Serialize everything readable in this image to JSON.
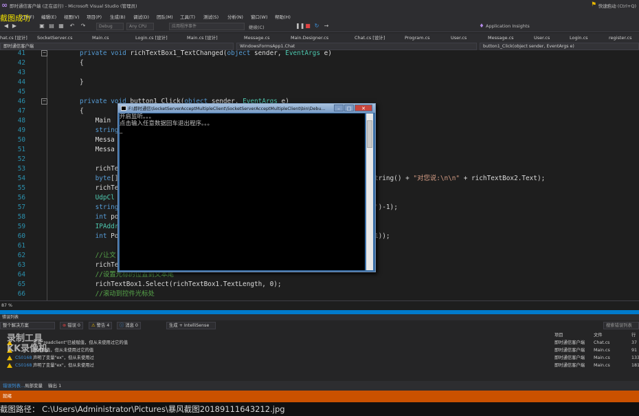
{
  "title_bar": {
    "title": "即时通信客户端 (正在运行) - Microsoft Visual Studio (管理员)",
    "signin": "快速启动 (Ctrl+Q)",
    "capture_note": "截图成功"
  },
  "menu": [
    "文件(F)",
    "编辑(E)",
    "视图(V)",
    "项目(P)",
    "生成(B)",
    "调试(D)",
    "团队(M)",
    "工具(T)",
    "测试(S)",
    "分析(N)",
    "窗口(W)",
    "帮助(H)"
  ],
  "toolbar": {
    "config": "Debug",
    "platform": "Any CPU",
    "process": "应用程序事件",
    "continue": "继续(C)",
    "app_insights": "Application Insights"
  },
  "tabs": [
    "hat.cs [设计]",
    "SocketServer.cs",
    "Main.cs",
    "Login.cs [设计]",
    "Main.cs [设计]",
    "Message.cs",
    "Main.Designer.cs",
    "Chat.cs [设计]",
    "Program.cs",
    "User.cs",
    "Message.cs",
    "User.cs",
    "Login.cs",
    "register.cs"
  ],
  "nav": {
    "project": "即时通信客户端",
    "class": "WindowsFormsApp1.Chat",
    "member": "button1_Click(object sender, EventArgs e)"
  },
  "code_lines": [
    {
      "n": "41",
      "parts": [
        [
          "kw",
          "private void "
        ],
        [
          "pl",
          "richTextBox1_TextChanged("
        ],
        [
          "kw",
          "object"
        ],
        [
          "pl",
          " sender, "
        ],
        [
          "ty",
          "EventArgs"
        ],
        [
          "pl",
          " e)"
        ]
      ]
    },
    {
      "n": "42",
      "parts": [
        [
          "pl",
          "{"
        ]
      ]
    },
    {
      "n": "43",
      "parts": [
        [
          "pl",
          ""
        ]
      ]
    },
    {
      "n": "44",
      "parts": [
        [
          "pl",
          "}"
        ]
      ]
    },
    {
      "n": "45",
      "parts": [
        [
          "pl",
          ""
        ]
      ]
    },
    {
      "n": "46",
      "parts": [
        [
          "kw",
          "private void "
        ],
        [
          "pl",
          "button1_Click("
        ],
        [
          "kw",
          "object"
        ],
        [
          "pl",
          " sender, "
        ],
        [
          "ty",
          "EventArgs"
        ],
        [
          "pl",
          " e)"
        ]
      ]
    },
    {
      "n": "47",
      "parts": [
        [
          "pl",
          "{"
        ]
      ]
    },
    {
      "n": "48",
      "parts": [
        [
          "pl",
          "    Main "
        ]
      ]
    },
    {
      "n": "49",
      "parts": [
        [
          "pl",
          "    "
        ],
        [
          "kw",
          "string"
        ]
      ]
    },
    {
      "n": "50",
      "parts": [
        [
          "pl",
          "    Messa                                                    oString());"
        ]
      ]
    },
    {
      "n": "51",
      "parts": [
        [
          "pl",
          "    Messa"
        ]
      ]
    },
    {
      "n": "52",
      "parts": [
        [
          "pl",
          ""
        ]
      ]
    },
    {
      "n": "53",
      "parts": [
        [
          "pl",
          "    richTe"
        ]
      ]
    },
    {
      "n": "54",
      "parts": [
        [
          "pl",
          "    "
        ],
        [
          "kw",
          "byte"
        ],
        [
          "pl",
          "[]                                                  "
        ],
        [
          "ty",
          "DateTime"
        ],
        [
          "pl",
          ".Now.ToString() + "
        ],
        [
          "st",
          "\"对您说:\\n\\n\""
        ],
        [
          "pl",
          " + richTextBox2.Text);"
        ]
      ]
    },
    {
      "n": "55",
      "parts": [
        [
          "pl",
          "    richTe"
        ]
      ]
    },
    {
      "n": "56",
      "parts": [
        [
          "pl",
          "    "
        ],
        [
          "ty",
          "UdpCl"
        ]
      ]
    },
    {
      "n": "57",
      "parts": [
        [
          "pl",
          "    "
        ],
        [
          "kw",
          "string"
        ],
        [
          "pl",
          "                                                  _Info.IndexOf("
        ],
        [
          "st",
          "'@'"
        ],
        [
          "pl",
          ")-1);"
        ]
      ]
    },
    {
      "n": "58",
      "parts": [
        [
          "pl",
          "    "
        ],
        [
          "kw",
          "int"
        ],
        [
          "pl",
          " po"
        ]
      ]
    },
    {
      "n": "59",
      "parts": [
        [
          "pl",
          "    "
        ],
        [
          "ty",
          "IPAddr"
        ]
      ]
    },
    {
      "n": "60",
      "parts": [
        [
          "pl",
          "    "
        ],
        [
          "kw",
          "int"
        ],
        [
          "pl",
          " Po                                                  th - pointIndex-1));"
        ]
      ]
    },
    {
      "n": "61",
      "parts": [
        [
          "pl",
          ""
        ]
      ]
    },
    {
      "n": "62",
      "parts": [
        [
          "pl",
          "    "
        ],
        [
          "cm",
          "//让文"
        ]
      ]
    },
    {
      "n": "63",
      "parts": [
        [
          "pl",
          "    richTe"
        ]
      ]
    },
    {
      "n": "64",
      "parts": [
        [
          "pl",
          "    "
        ],
        [
          "cm",
          "//设置光标的位置到文本尾"
        ]
      ]
    },
    {
      "n": "65",
      "parts": [
        [
          "pl",
          "    richTextBox1.Select(richTextBox1.TextLength, 0);"
        ]
      ]
    },
    {
      "n": "66",
      "parts": [
        [
          "pl",
          "    "
        ],
        [
          "cm",
          "//滚动到控件光标处"
        ]
      ]
    }
  ],
  "console": {
    "title": "F:\\即时通信\\SocketServerAcceptMultipleClient\\SocketServerAcceptMultipleClient\\bin\\Debu...",
    "lines": [
      "开启监听。。。",
      "点击输入任意数据回车退出程序。。。",
      "_"
    ]
  },
  "zoom": "87 %",
  "error_list": {
    "header": "错误列表",
    "scope": "整个解决方案",
    "errors": "错误 0",
    "warnings": "警告 4",
    "messages": "消息 0",
    "build": "生成 + IntelliSense",
    "search": "搜索错误列表",
    "col_project": "项目",
    "col_file": "文件",
    "col_line": "行",
    "rows": [
      {
        "code": "",
        "msg": "变量\"readclient\"已被赋值，但从未使用过它的值",
        "proj": "即时通信客户端",
        "file": "Chat.cs",
        "line": "37"
      },
      {
        "code": "",
        "msg": "已被赋值，但从未使用过它的值",
        "proj": "即时通信客户端",
        "file": "Main.cs",
        "line": "91"
      },
      {
        "code": "CS0168",
        "msg": "声明了变量\"ex\"，但从未使用过",
        "proj": "即时通信客户端",
        "file": "Main.cs",
        "line": "133"
      },
      {
        "code": "CS0168",
        "msg": "声明了变量\"ex\"，但从未使用过",
        "proj": "即时通信客户端",
        "file": "Main.cs",
        "line": "181"
      }
    ],
    "watermark": [
      "录制工具",
      "KK录像机"
    ]
  },
  "bottom_tabs": [
    "错误列表...",
    "局部变量",
    "输出 1"
  ],
  "status": "就绪",
  "path_text": "截图路径： C:\\Users\\Administrator\\Pictures\\暴风截图20189111643212.jpg",
  "colors": {
    "accent": "#007acc",
    "status_running": "#ca5100"
  }
}
